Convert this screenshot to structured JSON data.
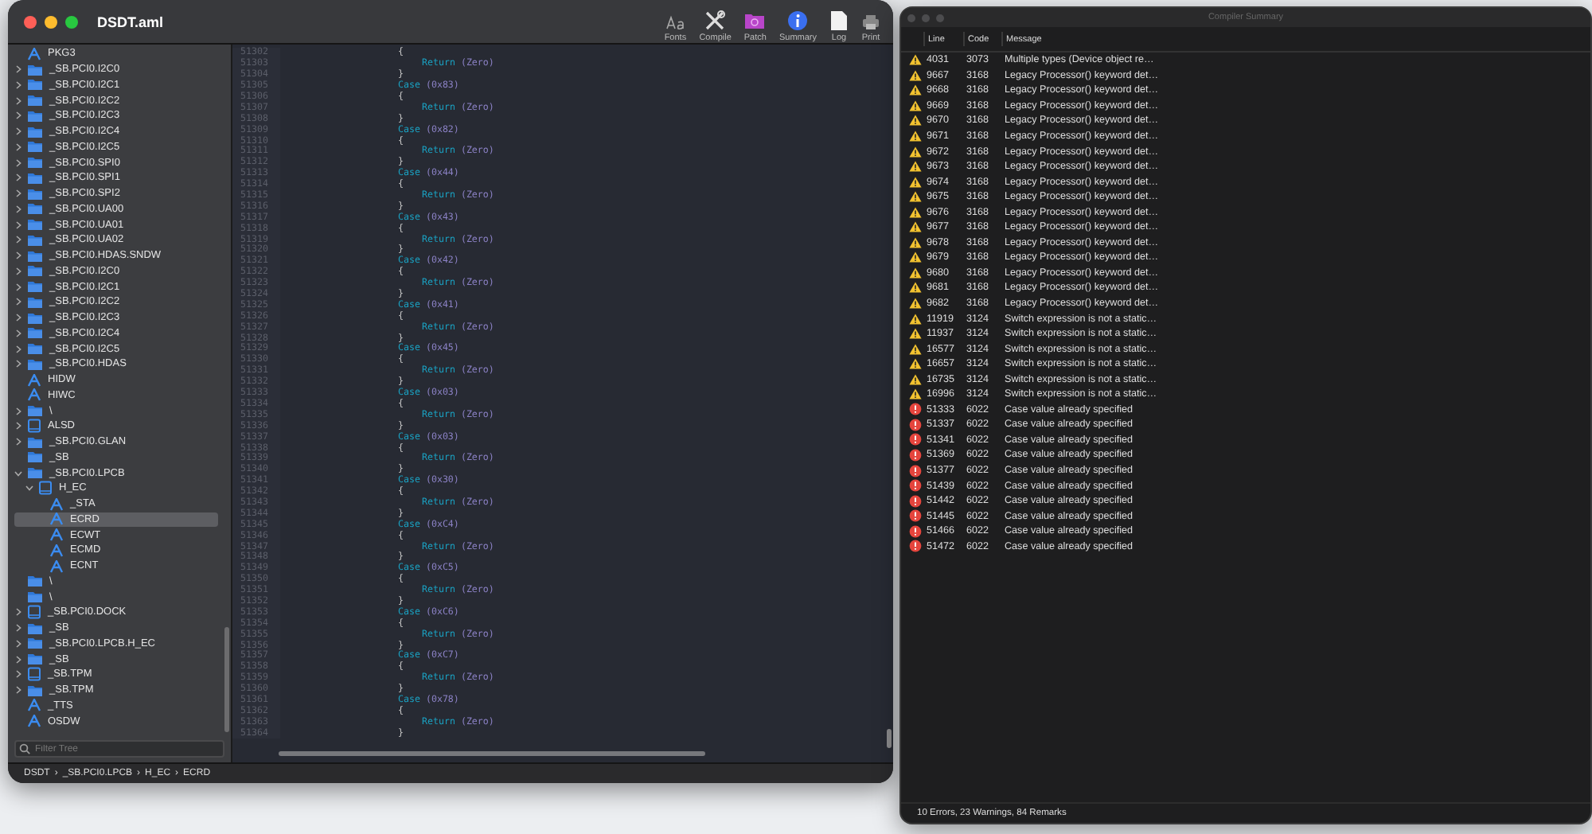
{
  "window": {
    "title": "DSDT.aml"
  },
  "toolbar": [
    {
      "label": "Fonts",
      "kind": "fonts"
    },
    {
      "label": "Compile",
      "kind": "compile"
    },
    {
      "label": "Patch",
      "kind": "patch"
    },
    {
      "label": "Summary",
      "kind": "summary"
    },
    {
      "label": "Log",
      "kind": "log"
    },
    {
      "label": "Print",
      "kind": "print"
    }
  ],
  "sidebar": {
    "tree": [
      {
        "label": "PKG3",
        "kind": "method",
        "selected": false
      },
      {
        "label": "_SB.PCI0.I2C0",
        "kind": "scope",
        "expanded": false,
        "selected": false
      },
      {
        "label": "_SB.PCI0.I2C1",
        "kind": "scope",
        "expanded": false,
        "selected": false
      },
      {
        "label": "_SB.PCI0.I2C2",
        "kind": "scope",
        "expanded": false,
        "selected": false
      },
      {
        "label": "_SB.PCI0.I2C3",
        "kind": "scope",
        "expanded": false,
        "selected": false
      },
      {
        "label": "_SB.PCI0.I2C4",
        "kind": "scope",
        "expanded": false,
        "selected": false
      },
      {
        "label": "_SB.PCI0.I2C5",
        "kind": "scope",
        "expanded": false,
        "selected": false
      },
      {
        "label": "_SB.PCI0.SPI0",
        "kind": "scope",
        "expanded": false,
        "selected": false
      },
      {
        "label": "_SB.PCI0.SPI1",
        "kind": "scope",
        "expanded": false,
        "selected": false
      },
      {
        "label": "_SB.PCI0.SPI2",
        "kind": "scope",
        "expanded": false,
        "selected": false
      },
      {
        "label": "_SB.PCI0.UA00",
        "kind": "scope",
        "expanded": false,
        "selected": false
      },
      {
        "label": "_SB.PCI0.UA01",
        "kind": "scope",
        "expanded": false,
        "selected": false
      },
      {
        "label": "_SB.PCI0.UA02",
        "kind": "scope",
        "expanded": false,
        "selected": false
      },
      {
        "label": "_SB.PCI0.HDAS.SNDW",
        "kind": "scope",
        "expanded": false,
        "selected": false
      },
      {
        "label": "_SB.PCI0.I2C0",
        "kind": "scope",
        "expanded": false,
        "selected": false
      },
      {
        "label": "_SB.PCI0.I2C1",
        "kind": "scope",
        "expanded": false,
        "selected": false
      },
      {
        "label": "_SB.PCI0.I2C2",
        "kind": "scope",
        "expanded": false,
        "selected": false
      },
      {
        "label": "_SB.PCI0.I2C3",
        "kind": "scope",
        "expanded": false,
        "selected": false
      },
      {
        "label": "_SB.PCI0.I2C4",
        "kind": "scope",
        "expanded": false,
        "selected": false
      },
      {
        "label": "_SB.PCI0.I2C5",
        "kind": "scope",
        "expanded": false,
        "selected": false
      },
      {
        "label": "_SB.PCI0.HDAS",
        "kind": "scope",
        "expanded": false,
        "selected": false
      },
      {
        "label": "HIDW",
        "kind": "method",
        "selected": false
      },
      {
        "label": "HIWC",
        "kind": "method",
        "selected": false
      },
      {
        "label": "\\",
        "kind": "scope",
        "expanded": false,
        "selected": false
      },
      {
        "label": "ALSD",
        "kind": "device",
        "expanded": false,
        "selected": false
      },
      {
        "label": "_SB.PCI0.GLAN",
        "kind": "scope",
        "expanded": false,
        "selected": false
      },
      {
        "label": "_SB",
        "kind": "scope",
        "selected": false
      },
      {
        "label": "_SB.PCI0.LPCB",
        "kind": "scope",
        "expanded": true,
        "selected": false,
        "children": [
          {
            "label": "H_EC",
            "kind": "device",
            "expanded": true,
            "selected": false,
            "children": [
              {
                "label": "_STA",
                "kind": "method",
                "selected": false
              },
              {
                "label": "ECRD",
                "kind": "method",
                "selected": true
              },
              {
                "label": "ECWT",
                "kind": "method",
                "selected": false
              },
              {
                "label": "ECMD",
                "kind": "method",
                "selected": false
              },
              {
                "label": "ECNT",
                "kind": "method",
                "selected": false
              }
            ]
          }
        ]
      },
      {
        "label": "\\",
        "kind": "scope",
        "selected": false
      },
      {
        "label": "\\",
        "kind": "scope",
        "selected": false
      },
      {
        "label": "_SB.PCI0.DOCK",
        "kind": "device",
        "expanded": false,
        "selected": false
      },
      {
        "label": "_SB",
        "kind": "scope",
        "expanded": false,
        "selected": false
      },
      {
        "label": "_SB.PCI0.LPCB.H_EC",
        "kind": "scope",
        "expanded": false,
        "selected": false
      },
      {
        "label": "_SB",
        "kind": "scope",
        "expanded": false,
        "selected": false
      },
      {
        "label": "_SB.TPM",
        "kind": "device",
        "expanded": false,
        "selected": false
      },
      {
        "label": "_SB.TPM",
        "kind": "scope",
        "expanded": false,
        "selected": false
      },
      {
        "label": "_TTS",
        "kind": "method",
        "selected": false
      },
      {
        "label": "OSDW",
        "kind": "method",
        "selected": false
      }
    ],
    "filter": {
      "placeholder": "Filter Tree"
    }
  },
  "editor": {
    "lines": [
      {
        "n": "51302",
        "kind": "open",
        "text": "{"
      },
      {
        "n": "51303",
        "kind": "return",
        "keyword": "Return",
        "arg": "(Zero)"
      },
      {
        "n": "51304",
        "kind": "close",
        "text": "}"
      },
      {
        "n": "51305",
        "kind": "case",
        "keyword": "Case",
        "arg": "(0x83)"
      },
      {
        "n": "51306",
        "kind": "open",
        "text": "{"
      },
      {
        "n": "51307",
        "kind": "return",
        "keyword": "Return",
        "arg": "(Zero)"
      },
      {
        "n": "51308",
        "kind": "close",
        "text": "}"
      },
      {
        "n": "51309",
        "kind": "case",
        "keyword": "Case",
        "arg": "(0x82)"
      },
      {
        "n": "51310",
        "kind": "open",
        "text": "{"
      },
      {
        "n": "51311",
        "kind": "return",
        "keyword": "Return",
        "arg": "(Zero)"
      },
      {
        "n": "51312",
        "kind": "close",
        "text": "}"
      },
      {
        "n": "51313",
        "kind": "case",
        "keyword": "Case",
        "arg": "(0x44)"
      },
      {
        "n": "51314",
        "kind": "open",
        "text": "{"
      },
      {
        "n": "51315",
        "kind": "return",
        "keyword": "Return",
        "arg": "(Zero)"
      },
      {
        "n": "51316",
        "kind": "close",
        "text": "}"
      },
      {
        "n": "51317",
        "kind": "case",
        "keyword": "Case",
        "arg": "(0x43)"
      },
      {
        "n": "51318",
        "kind": "open",
        "text": "{"
      },
      {
        "n": "51319",
        "kind": "return",
        "keyword": "Return",
        "arg": "(Zero)"
      },
      {
        "n": "51320",
        "kind": "close",
        "text": "}"
      },
      {
        "n": "51321",
        "kind": "case",
        "keyword": "Case",
        "arg": "(0x42)"
      },
      {
        "n": "51322",
        "kind": "open",
        "text": "{"
      },
      {
        "n": "51323",
        "kind": "return",
        "keyword": "Return",
        "arg": "(Zero)"
      },
      {
        "n": "51324",
        "kind": "close",
        "text": "}"
      },
      {
        "n": "51325",
        "kind": "case",
        "keyword": "Case",
        "arg": "(0x41)"
      },
      {
        "n": "51326",
        "kind": "open",
        "text": "{"
      },
      {
        "n": "51327",
        "kind": "return",
        "keyword": "Return",
        "arg": "(Zero)"
      },
      {
        "n": "51328",
        "kind": "close",
        "text": "}"
      },
      {
        "n": "51329",
        "kind": "case",
        "keyword": "Case",
        "arg": "(0x45)"
      },
      {
        "n": "51330",
        "kind": "open",
        "text": "{"
      },
      {
        "n": "51331",
        "kind": "return",
        "keyword": "Return",
        "arg": "(Zero)"
      },
      {
        "n": "51332",
        "kind": "close",
        "text": "}"
      },
      {
        "n": "51333",
        "kind": "case",
        "keyword": "Case",
        "arg": "(0x03)"
      },
      {
        "n": "51334",
        "kind": "open",
        "text": "{"
      },
      {
        "n": "51335",
        "kind": "return",
        "keyword": "Return",
        "arg": "(Zero)"
      },
      {
        "n": "51336",
        "kind": "close",
        "text": "}"
      },
      {
        "n": "51337",
        "kind": "case",
        "keyword": "Case",
        "arg": "(0x03)"
      },
      {
        "n": "51338",
        "kind": "open",
        "text": "{"
      },
      {
        "n": "51339",
        "kind": "return",
        "keyword": "Return",
        "arg": "(Zero)"
      },
      {
        "n": "51340",
        "kind": "close",
        "text": "}"
      },
      {
        "n": "51341",
        "kind": "case",
        "keyword": "Case",
        "arg": "(0x30)"
      },
      {
        "n": "51342",
        "kind": "open",
        "text": "{"
      },
      {
        "n": "51343",
        "kind": "return",
        "keyword": "Return",
        "arg": "(Zero)"
      },
      {
        "n": "51344",
        "kind": "close",
        "text": "}"
      },
      {
        "n": "51345",
        "kind": "case",
        "keyword": "Case",
        "arg": "(0xC4)"
      },
      {
        "n": "51346",
        "kind": "open",
        "text": "{"
      },
      {
        "n": "51347",
        "kind": "return",
        "keyword": "Return",
        "arg": "(Zero)"
      },
      {
        "n": "51348",
        "kind": "close",
        "text": "}"
      },
      {
        "n": "51349",
        "kind": "case",
        "keyword": "Case",
        "arg": "(0xC5)"
      },
      {
        "n": "51350",
        "kind": "open",
        "text": "{"
      },
      {
        "n": "51351",
        "kind": "return",
        "keyword": "Return",
        "arg": "(Zero)"
      },
      {
        "n": "51352",
        "kind": "close",
        "text": "}"
      },
      {
        "n": "51353",
        "kind": "case",
        "keyword": "Case",
        "arg": "(0xC6)"
      },
      {
        "n": "51354",
        "kind": "open",
        "text": "{"
      },
      {
        "n": "51355",
        "kind": "return",
        "keyword": "Return",
        "arg": "(Zero)"
      },
      {
        "n": "51356",
        "kind": "close",
        "text": "}"
      },
      {
        "n": "51357",
        "kind": "case",
        "keyword": "Case",
        "arg": "(0xC7)"
      },
      {
        "n": "51358",
        "kind": "open",
        "text": "{"
      },
      {
        "n": "51359",
        "kind": "return",
        "keyword": "Return",
        "arg": "(Zero)"
      },
      {
        "n": "51360",
        "kind": "close",
        "text": "}"
      },
      {
        "n": "51361",
        "kind": "case",
        "keyword": "Case",
        "arg": "(0x78)"
      },
      {
        "n": "51362",
        "kind": "open",
        "text": "{"
      },
      {
        "n": "51363",
        "kind": "return",
        "keyword": "Return",
        "arg": "(Zero)"
      },
      {
        "n": "51364",
        "kind": "close",
        "text": "}"
      }
    ]
  },
  "breadcrumb": {
    "separator": "›",
    "items": [
      "DSDT",
      "_SB.PCI0.LPCB",
      "H_EC",
      "ECRD"
    ]
  },
  "compiler_summary": {
    "title": "Compiler Summary",
    "columns": [
      "Line",
      "Code",
      "Message"
    ],
    "rows": [
      {
        "kind": "warning",
        "line": "4031",
        "code": "3073",
        "message": "Multiple types (Device object re…"
      },
      {
        "kind": "warning",
        "line": "9667",
        "code": "3168",
        "message": "Legacy Processor() keyword det…"
      },
      {
        "kind": "warning",
        "line": "9668",
        "code": "3168",
        "message": "Legacy Processor() keyword det…"
      },
      {
        "kind": "warning",
        "line": "9669",
        "code": "3168",
        "message": "Legacy Processor() keyword det…"
      },
      {
        "kind": "warning",
        "line": "9670",
        "code": "3168",
        "message": "Legacy Processor() keyword det…"
      },
      {
        "kind": "warning",
        "line": "9671",
        "code": "3168",
        "message": "Legacy Processor() keyword det…"
      },
      {
        "kind": "warning",
        "line": "9672",
        "code": "3168",
        "message": "Legacy Processor() keyword det…"
      },
      {
        "kind": "warning",
        "line": "9673",
        "code": "3168",
        "message": "Legacy Processor() keyword det…"
      },
      {
        "kind": "warning",
        "line": "9674",
        "code": "3168",
        "message": "Legacy Processor() keyword det…"
      },
      {
        "kind": "warning",
        "line": "9675",
        "code": "3168",
        "message": "Legacy Processor() keyword det…"
      },
      {
        "kind": "warning",
        "line": "9676",
        "code": "3168",
        "message": "Legacy Processor() keyword det…"
      },
      {
        "kind": "warning",
        "line": "9677",
        "code": "3168",
        "message": "Legacy Processor() keyword det…"
      },
      {
        "kind": "warning",
        "line": "9678",
        "code": "3168",
        "message": "Legacy Processor() keyword det…"
      },
      {
        "kind": "warning",
        "line": "9679",
        "code": "3168",
        "message": "Legacy Processor() keyword det…"
      },
      {
        "kind": "warning",
        "line": "9680",
        "code": "3168",
        "message": "Legacy Processor() keyword det…"
      },
      {
        "kind": "warning",
        "line": "9681",
        "code": "3168",
        "message": "Legacy Processor() keyword det…"
      },
      {
        "kind": "warning",
        "line": "9682",
        "code": "3168",
        "message": "Legacy Processor() keyword det…"
      },
      {
        "kind": "warning",
        "line": "11919",
        "code": "3124",
        "message": "Switch expression is not a static…"
      },
      {
        "kind": "warning",
        "line": "11937",
        "code": "3124",
        "message": "Switch expression is not a static…"
      },
      {
        "kind": "warning",
        "line": "16577",
        "code": "3124",
        "message": "Switch expression is not a static…"
      },
      {
        "kind": "warning",
        "line": "16657",
        "code": "3124",
        "message": "Switch expression is not a static…"
      },
      {
        "kind": "warning",
        "line": "16735",
        "code": "3124",
        "message": "Switch expression is not a static…"
      },
      {
        "kind": "warning",
        "line": "16996",
        "code": "3124",
        "message": "Switch expression is not a static…"
      },
      {
        "kind": "error",
        "line": "51333",
        "code": "6022",
        "message": "Case value already specified"
      },
      {
        "kind": "error",
        "line": "51337",
        "code": "6022",
        "message": "Case value already specified"
      },
      {
        "kind": "error",
        "line": "51341",
        "code": "6022",
        "message": "Case value already specified"
      },
      {
        "kind": "error",
        "line": "51369",
        "code": "6022",
        "message": "Case value already specified"
      },
      {
        "kind": "error",
        "line": "51377",
        "code": "6022",
        "message": "Case value already specified"
      },
      {
        "kind": "error",
        "line": "51439",
        "code": "6022",
        "message": "Case value already specified"
      },
      {
        "kind": "error",
        "line": "51442",
        "code": "6022",
        "message": "Case value already specified"
      },
      {
        "kind": "error",
        "line": "51445",
        "code": "6022",
        "message": "Case value already specified"
      },
      {
        "kind": "error",
        "line": "51466",
        "code": "6022",
        "message": "Case value already specified"
      },
      {
        "kind": "error",
        "line": "51472",
        "code": "6022",
        "message": "Case value already specified"
      }
    ],
    "status": "10 Errors, 23 Warnings, 84 Remarks"
  }
}
